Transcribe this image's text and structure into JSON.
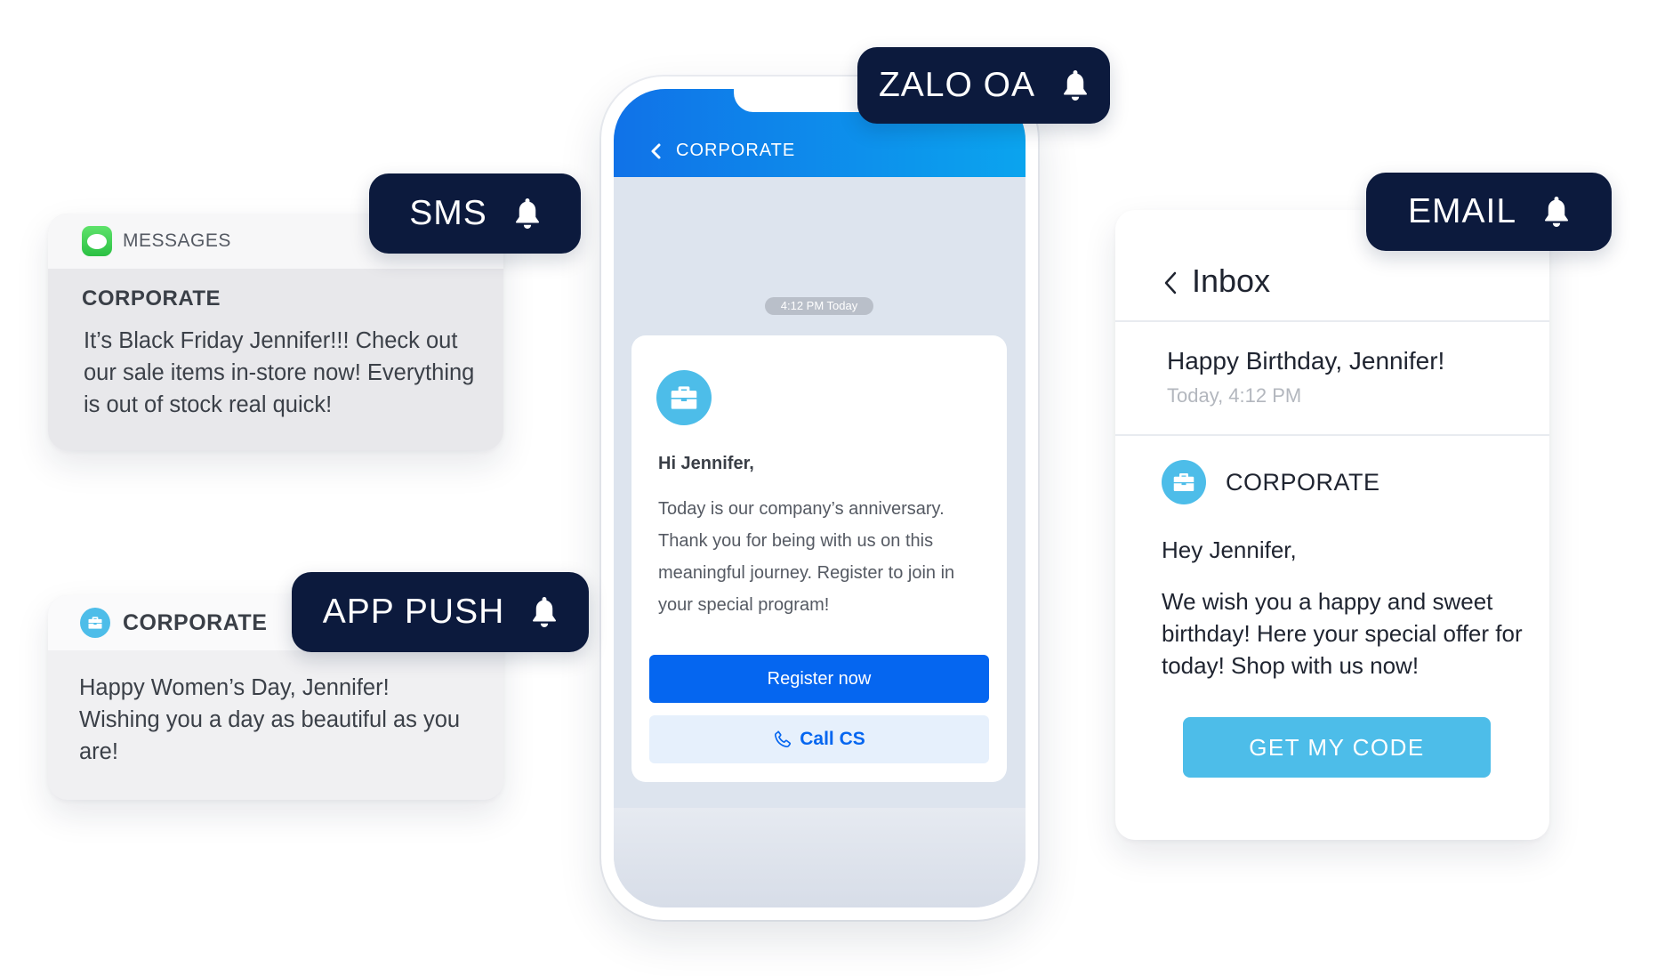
{
  "colors": {
    "badge_bg": "#0c1a3d",
    "zalo_blue": "#0566f0",
    "brand_cyan": "#4dbde9"
  },
  "badges": {
    "sms": "SMS",
    "app_push": "APP PUSH",
    "zalo": "ZALO OA",
    "email": "EMAIL",
    "icon": "bell-icon"
  },
  "sms": {
    "app_name": "MESSAGES",
    "app_icon": "messages-icon",
    "sender": "CORPORATE",
    "body": "It’s Black Friday Jennifer!!! Check out our sale items in-store now! Everything is out of stock real quick!"
  },
  "push": {
    "app_icon": "briefcase-icon",
    "app_name": "CORPORATE",
    "body": "Happy Women’s Day, Jennifer! Wishing you a day as beautiful as you are!"
  },
  "zalo": {
    "header_title": "CORPORATE",
    "back_icon": "chevron-left-icon",
    "timestamp": "4:12 PM Today",
    "brand_icon": "briefcase-icon",
    "greeting": "Hi Jennifer,",
    "body": "Today is our company’s anniversary. Thank you for being with us on this meaningful journey. Register to join in your special program!",
    "primary_button": "Register now",
    "secondary_button": "Call CS",
    "secondary_icon": "phone-icon"
  },
  "email": {
    "back_label": "Inbox",
    "subject": "Happy Birthday, Jennifer!",
    "date": "Today, 4:12 PM",
    "sender": "CORPORATE",
    "greeting": "Hey Jennifer,",
    "body": "We wish you a happy and sweet birthday! Here your special offer for today! Shop with us now!",
    "cta": "GET MY CODE"
  }
}
